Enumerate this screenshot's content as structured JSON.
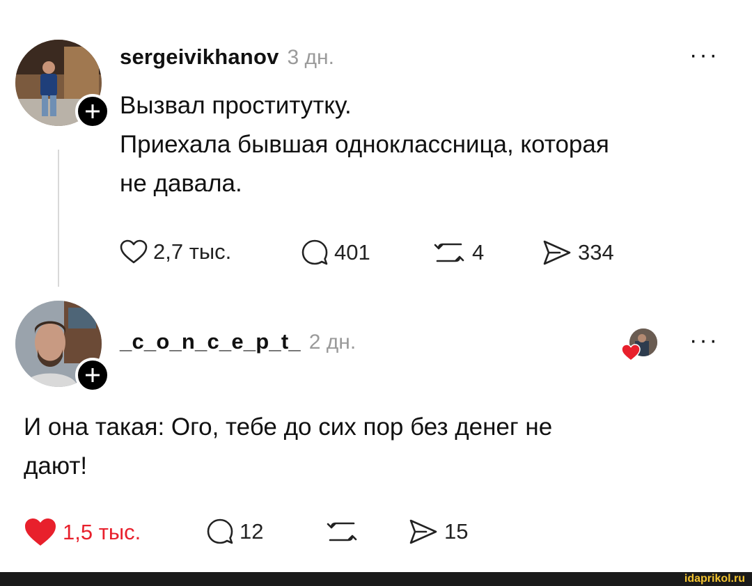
{
  "posts": [
    {
      "username": "sergeivikhanov",
      "time": "3 дн.",
      "more": "···",
      "text_lines": [
        "Вызвал проститутку.",
        "Приехала бывшая одноклассница, которая",
        "не давала."
      ],
      "actions": {
        "likes": "2,7 тыс.",
        "comments": "401",
        "reposts": "4",
        "shares": "334"
      }
    },
    {
      "username": "_c_o_n_c_e_p_t_",
      "time": "2 дн.",
      "more": "···",
      "text_lines": [
        "И она такая: Ого, тебе до сих пор без денег не",
        "дают!"
      ],
      "actions": {
        "likes": "1,5 тыс.",
        "comments": "12",
        "shares": "15"
      }
    }
  ],
  "watermark": "idaprikol.ru",
  "colors": {
    "text": "#111111",
    "muted": "#9a9a9a",
    "like_red": "#e8202c",
    "footer": "#1a1a1a",
    "watermark": "#f4c430"
  }
}
